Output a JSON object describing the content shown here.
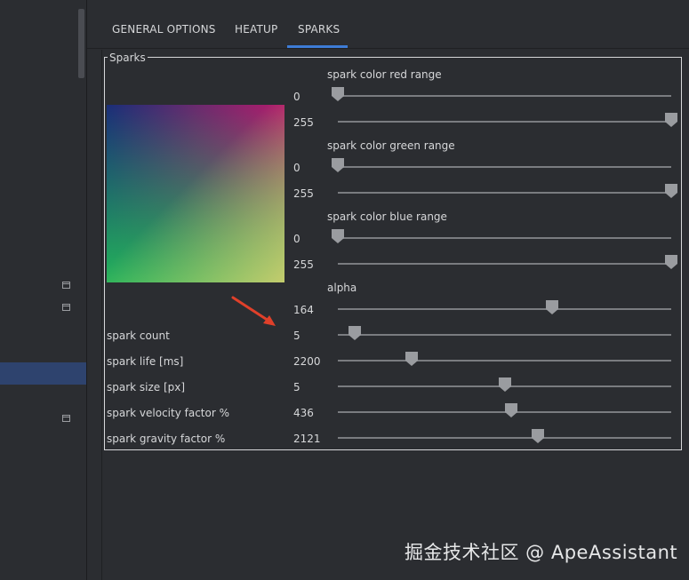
{
  "tabs": [
    {
      "label": "GENERAL OPTIONS"
    },
    {
      "label": "HEATUP"
    },
    {
      "label": "SPARKS",
      "active": true
    }
  ],
  "group": {
    "title": "Sparks"
  },
  "color_ranges": [
    {
      "label": "spark color red range",
      "min_value": "0",
      "max_value": "255",
      "min_fraction": 0.0,
      "max_fraction": 1.0
    },
    {
      "label": "spark color green range",
      "min_value": "0",
      "max_value": "255",
      "min_fraction": 0.0,
      "max_fraction": 1.0
    },
    {
      "label": "spark color blue range",
      "min_value": "0",
      "max_value": "255",
      "min_fraction": 0.0,
      "max_fraction": 1.0
    }
  ],
  "alpha": {
    "label": "alpha",
    "value": "164",
    "fraction": 0.643
  },
  "params": [
    {
      "label": "spark count",
      "value": "5",
      "fraction": 0.05
    },
    {
      "label": "spark life [ms]",
      "value": "2200",
      "fraction": 0.22
    },
    {
      "label": "spark size [px]",
      "value": "5",
      "fraction": 0.5
    },
    {
      "label": "spark velocity factor %",
      "value": "436",
      "fraction": 0.52
    },
    {
      "label": "spark gravity factor %",
      "value": "2121",
      "fraction": 0.6
    }
  ],
  "watermark": "掘金技术社区 @ ApeAssistant",
  "colors": {
    "accent": "#3d7cd6",
    "background": "#2b2d31",
    "selected_row": "#2e436e",
    "arrow": "#e0402a"
  },
  "icons": [
    "calendar-icon",
    "slider-thumb-icon",
    "arrow-annotation-icon"
  ]
}
